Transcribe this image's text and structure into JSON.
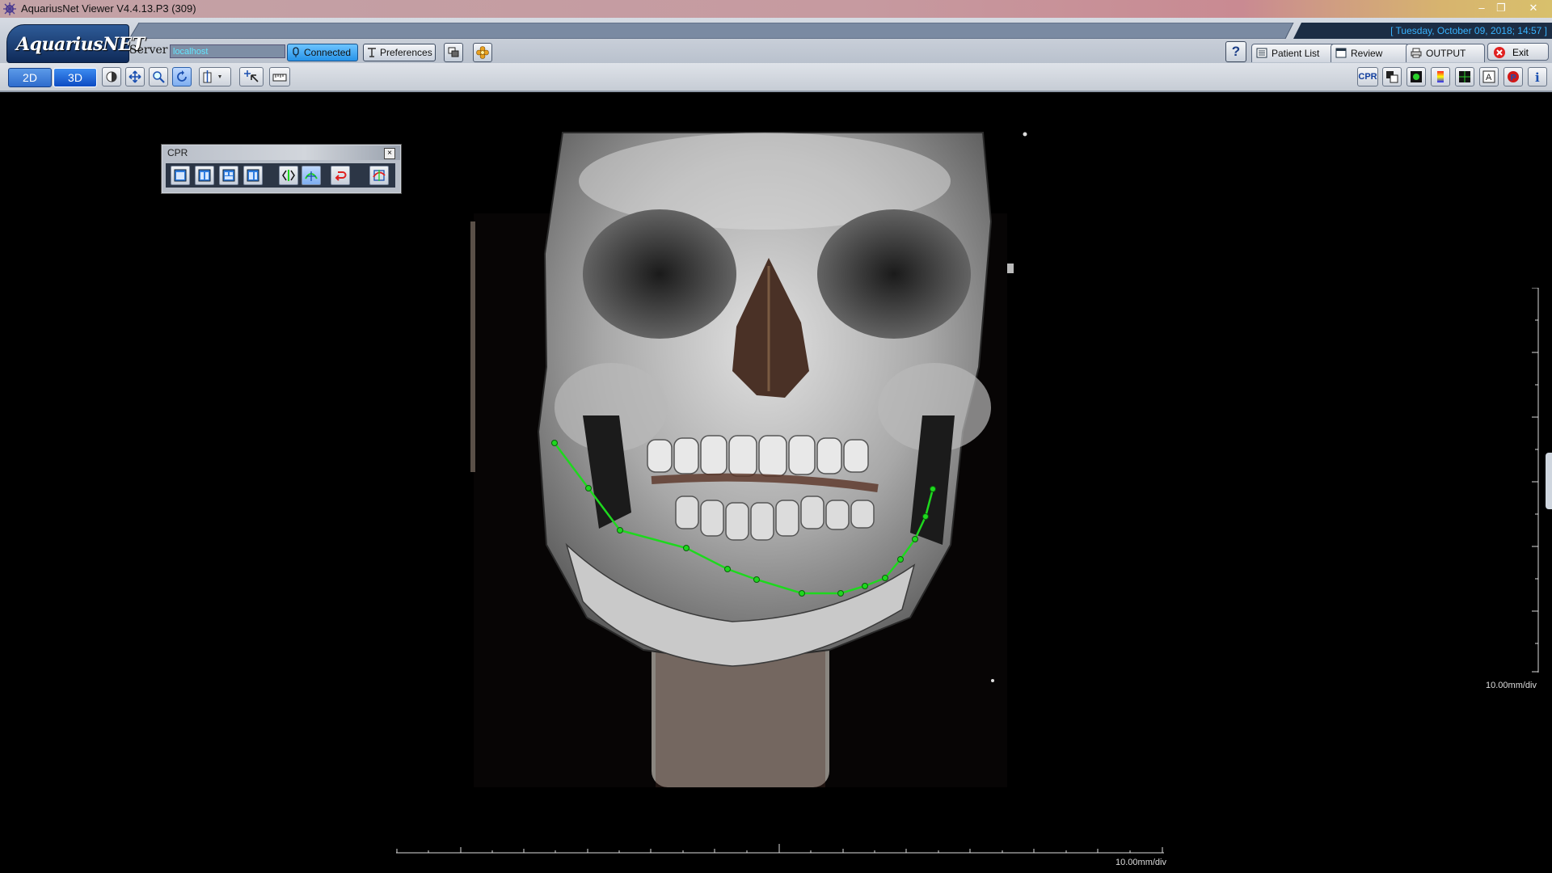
{
  "window": {
    "title": "AquariusNet Viewer   V4.4.13.P3 (309)",
    "controls": [
      "minimize-icon",
      "restore-icon",
      "close-icon"
    ]
  },
  "header": {
    "logo": "AquariusNET",
    "date": "[ Tuesday, October 09, 2018; 14:57 ]",
    "server_label": "Server",
    "server_value": "localhost",
    "connected_label": "Connected",
    "preferences_label": "Preferences",
    "help_label": "?",
    "tabs": [
      {
        "label": "Patient List",
        "icon": "patient-list-icon"
      },
      {
        "label": "Review",
        "icon": "review-window-icon"
      },
      {
        "label": "OUTPUT",
        "icon": "printer-icon"
      }
    ],
    "exit_label": "Exit"
  },
  "toolbar": {
    "mode_2d": "2D",
    "mode_3d": "3D",
    "active_mode": "3D",
    "tools": [
      "window-level-icon",
      "pan-icon",
      "zoom-icon",
      "rotate-icon",
      "cut-plane-icon",
      "pointer-icon",
      "ruler-icon"
    ],
    "active_tool": "rotate-icon",
    "right_tools": [
      "cpr-button",
      "layout-icon",
      "vr-icon",
      "color-lut-icon",
      "grid-icon",
      "annotation-icon",
      "p-icon",
      "info-icon"
    ],
    "cpr_label": "CPR"
  },
  "cpr_panel": {
    "title": "CPR",
    "close": "×",
    "buttons": [
      "layout-1-icon",
      "layout-2-icon",
      "layout-3-icon",
      "layout-4-icon",
      "flip-curve-icon",
      "edit-curve-icon",
      "undo-curve-icon",
      "curve-settings-icon"
    ]
  },
  "viewport": {
    "vertical_scale_label": "10.00mm/div",
    "horizontal_scale_label": "10.00mm/div",
    "curve_color": "#1ed81e",
    "curve_point_count": 14
  },
  "colors": {
    "accent_blue": "#0d4bc3",
    "date_text": "#38b3ff",
    "server_text": "#63e6ff",
    "exit_red": "#e02020"
  }
}
